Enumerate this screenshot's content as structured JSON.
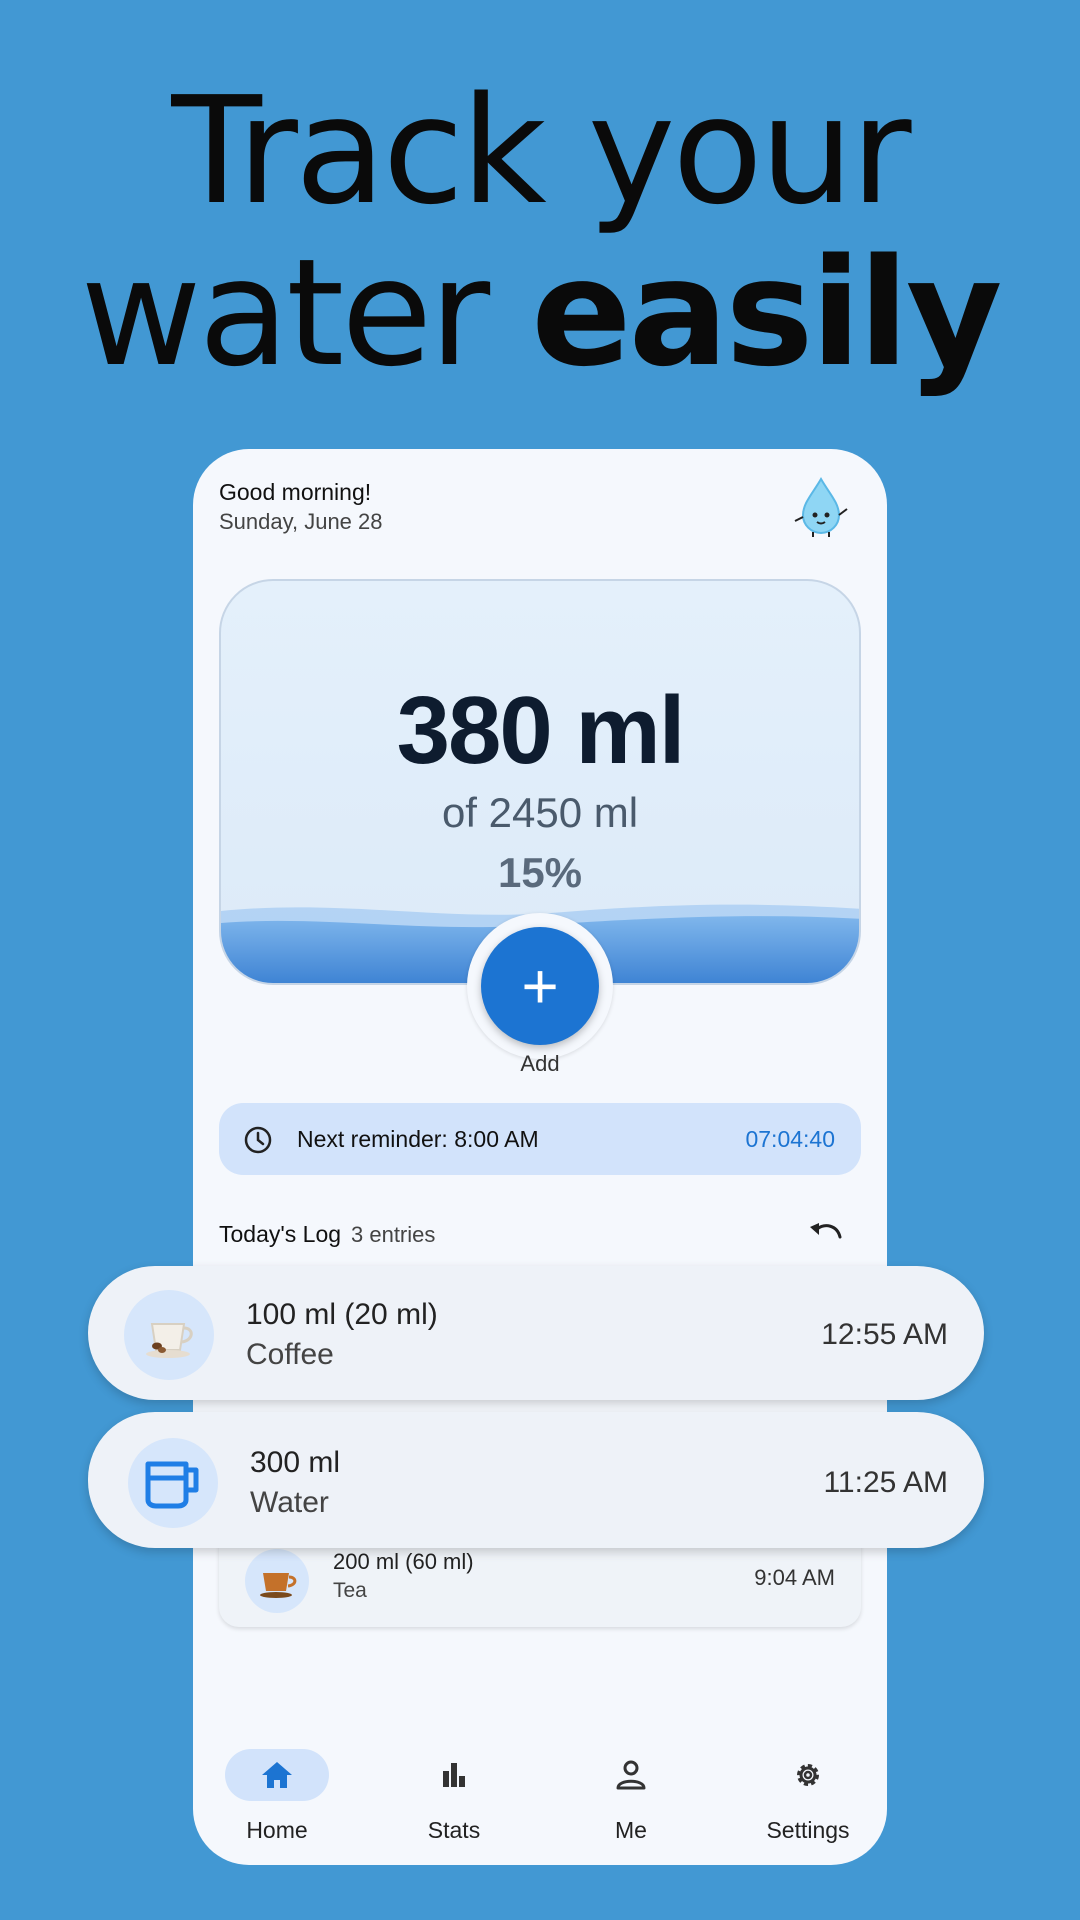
{
  "headline": {
    "line1": "Track your",
    "line2_light": "water ",
    "line2_bold": "easily"
  },
  "header": {
    "greeting": "Good morning!",
    "date": "Sunday, June 28",
    "mascot_icon": "water-drop-mascot-icon"
  },
  "progress": {
    "amount": "380 ml",
    "goal": "of 2450 ml",
    "percent": "15%",
    "fill_fraction": 0.15
  },
  "add": {
    "symbol": "+",
    "label": "Add"
  },
  "reminder": {
    "text": "Next reminder: 8:00 AM",
    "countdown": "07:04:40",
    "icon": "clock-icon"
  },
  "log": {
    "title": "Today's Log",
    "count": "3 entries",
    "undo_icon": "undo-icon",
    "entries": [
      {
        "amount": "100 ml (20 ml)",
        "kind": "Coffee",
        "time": "12:55 AM",
        "icon": "coffee-cup-icon"
      },
      {
        "amount": "300 ml",
        "kind": "Water",
        "time": "11:25 AM",
        "icon": "water-cup-icon"
      },
      {
        "amount": "200 ml (60 ml)",
        "kind": "Tea",
        "time": "9:04 AM",
        "icon": "tea-cup-icon"
      }
    ]
  },
  "nav": [
    {
      "label": "Home",
      "icon": "home-icon",
      "active": true
    },
    {
      "label": "Stats",
      "icon": "bar-chart-icon",
      "active": false
    },
    {
      "label": "Me",
      "icon": "person-icon",
      "active": false
    },
    {
      "label": "Settings",
      "icon": "gear-icon",
      "active": false
    }
  ],
  "colors": {
    "background": "#4298d3",
    "accent": "#1c74d2",
    "reminder_bg": "#d2e3fb"
  }
}
